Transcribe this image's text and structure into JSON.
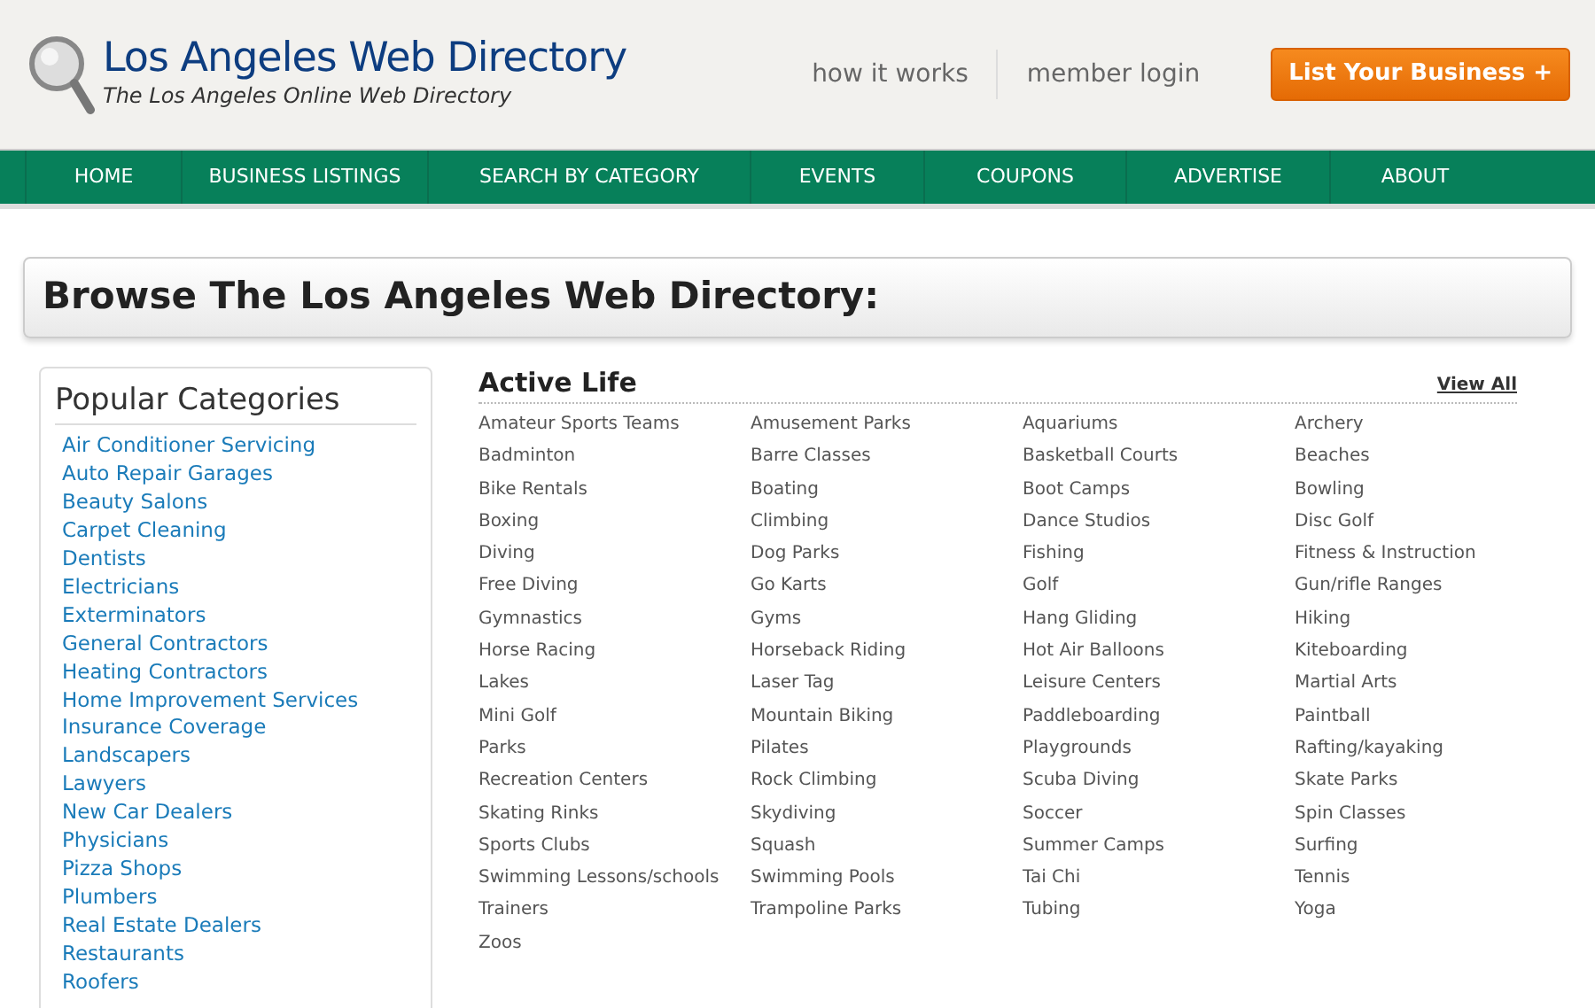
{
  "site": {
    "title": "Los Angeles Web Directory",
    "tagline": "The Los Angeles Online Web Directory"
  },
  "header_links": [
    "how it works",
    "member login"
  ],
  "cta_button": "List Your Business +",
  "nav": [
    "HOME",
    "BUSINESS LISTINGS",
    "SEARCH BY CATEGORY",
    "EVENTS",
    "COUPONS",
    "ADVERTISE",
    "ABOUT"
  ],
  "page_heading": "Browse The Los Angeles Web Directory:",
  "sidebar": {
    "title": "Popular Categories",
    "items": [
      "Air Conditioner Servicing",
      "Auto Repair Garages",
      "Beauty Salons",
      "Carpet Cleaning",
      "Dentists",
      "Electricians",
      "Exterminators",
      "General Contractors",
      "Heating Contractors",
      "Home Improvement Services",
      "Insurance Coverage",
      "Landscapers",
      "Lawyers",
      "New Car Dealers",
      "Physicians",
      "Pizza Shops",
      "Plumbers",
      "Real Estate Dealers",
      "Restaurants",
      "Roofers"
    ]
  },
  "section": {
    "title": "Active Life",
    "view_all": "View All",
    "items": [
      "Amateur Sports Teams",
      "Amusement Parks",
      "Aquariums",
      "Archery",
      "Badminton",
      "Barre Classes",
      "Basketball Courts",
      "Beaches",
      "Bike Rentals",
      "Boating",
      "Boot Camps",
      "Bowling",
      "Boxing",
      "Climbing",
      "Dance Studios",
      "Disc Golf",
      "Diving",
      "Dog Parks",
      "Fishing",
      "Fitness & Instruction",
      "Free Diving",
      "Go Karts",
      "Golf",
      "Gun/rifle Ranges",
      "Gymnastics",
      "Gyms",
      "Hang Gliding",
      "Hiking",
      "Horse Racing",
      "Horseback Riding",
      "Hot Air Balloons",
      "Kiteboarding",
      "Lakes",
      "Laser Tag",
      "Leisure Centers",
      "Martial Arts",
      "Mini Golf",
      "Mountain Biking",
      "Paddleboarding",
      "Paintball",
      "Parks",
      "Pilates",
      "Playgrounds",
      "Rafting/kayaking",
      "Recreation Centers",
      "Rock Climbing",
      "Scuba Diving",
      "Skate Parks",
      "Skating Rinks",
      "Skydiving",
      "Soccer",
      "Spin Classes",
      "Sports Clubs",
      "Squash",
      "Summer Camps",
      "Surfing",
      "Swimming Lessons/schools",
      "Swimming Pools",
      "Tai Chi",
      "Tennis",
      "Trainers",
      "Trampoline Parks",
      "Tubing",
      "Yoga",
      "Zoos"
    ]
  }
}
